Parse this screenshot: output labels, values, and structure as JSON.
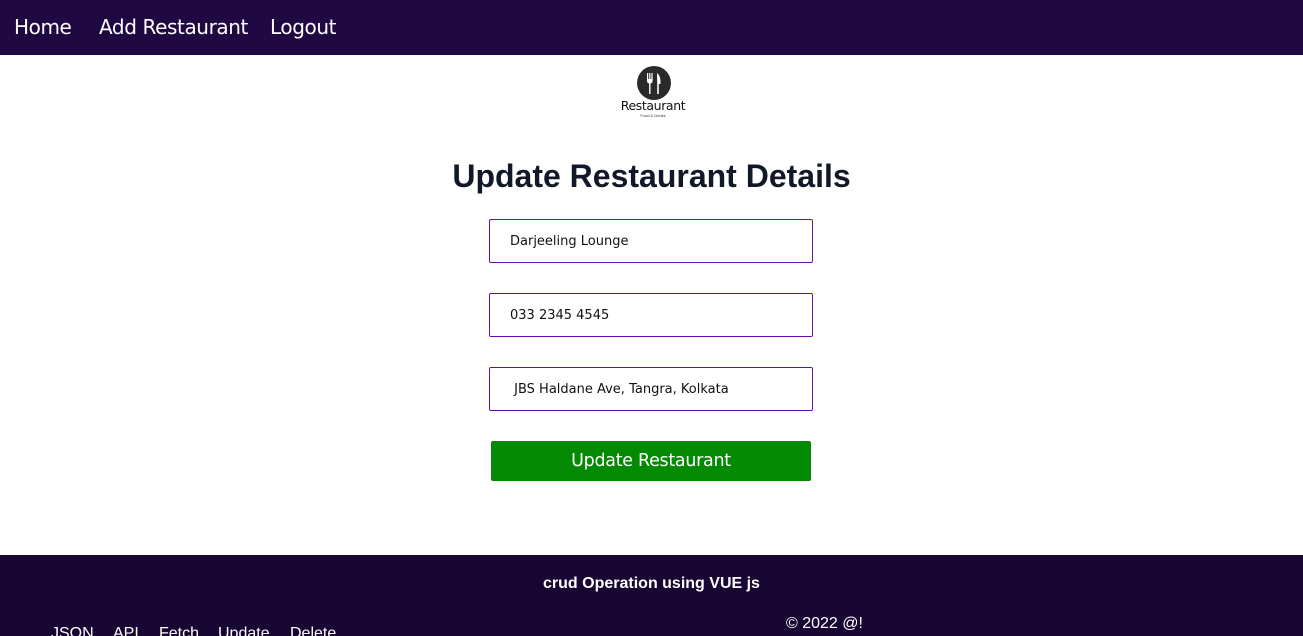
{
  "nav": {
    "home": "Home",
    "add_restaurant": "Add Restaurant",
    "logout": "Logout"
  },
  "logo": {
    "icon": "fork-knife-icon",
    "title": "Restaurant",
    "subtitle": "Food & Drinks"
  },
  "page_title": "Update Restaurant Details",
  "form": {
    "name": "Darjeeling Lounge",
    "contact": "033 2345 4545",
    "address": " JBS Haldane Ave, Tangra, Kolkata",
    "submit_label": "Update Restaurant"
  },
  "footer": {
    "heading": "crud Operation using VUE js",
    "links": [
      "JSON",
      "API",
      "Fetch",
      "Update",
      "Delete"
    ],
    "copyright": "© 2022 @!"
  },
  "colors": {
    "nav_bg": "#200942",
    "footer_bg": "#190733",
    "field_border": "#6a0dad",
    "button_bg": "#028b02"
  }
}
